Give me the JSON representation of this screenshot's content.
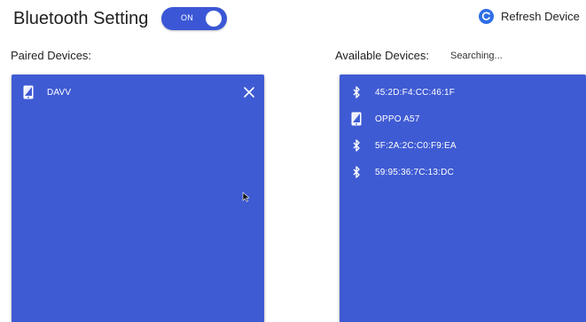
{
  "header": {
    "title": "Bluetooth Setting",
    "toggle_label": "ON",
    "refresh_label": "Refresh Device"
  },
  "paired": {
    "label": "Paired Devices:",
    "devices": [
      {
        "name": "DAVV",
        "icon": "phone-icon"
      }
    ]
  },
  "available": {
    "label": "Available Devices:",
    "status": "Searching...",
    "devices": [
      {
        "name": "45:2D:F4:CC:46:1F",
        "icon": "bluetooth-icon"
      },
      {
        "name": "OPPO A57",
        "icon": "phone-icon"
      },
      {
        "name": "5F:2A:2C:C0:F9:EA",
        "icon": "bluetooth-icon"
      },
      {
        "name": "59:95:36:7C:13:DC",
        "icon": "bluetooth-icon"
      }
    ]
  },
  "colors": {
    "accent": "#3b57d6",
    "panel": "#3f5bd3",
    "refresh_icon": "#2f6ee8"
  }
}
